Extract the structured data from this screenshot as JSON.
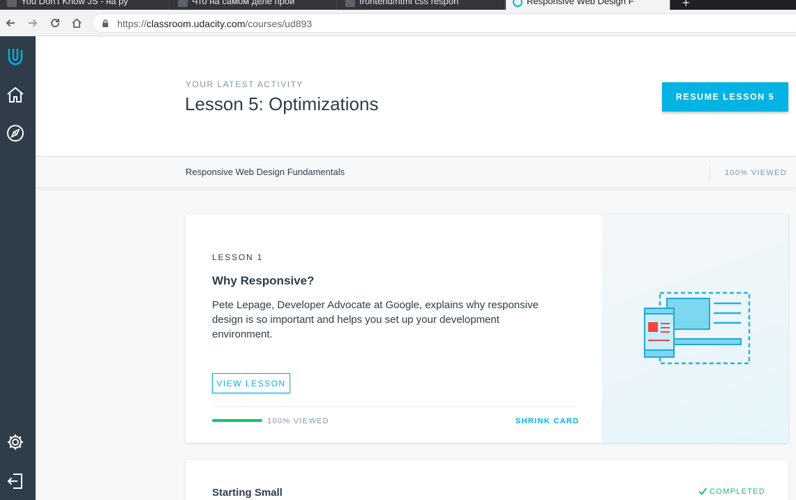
{
  "browser": {
    "tabs": [
      {
        "title": "You Don't Know JS - на ру"
      },
      {
        "title": "Что на самом деле прои"
      },
      {
        "title": "frontend/html css respon"
      },
      {
        "title": "Responsive Web Design F"
      }
    ],
    "url_scheme": "https://",
    "url_host": "classroom.udacity.com",
    "url_path": "/courses/ud893"
  },
  "sidebar": {
    "icons": [
      "udacity-logo-icon",
      "home-icon",
      "compass-icon",
      "settings-icon",
      "logout-icon"
    ]
  },
  "hero": {
    "eyebrow": "YOUR LATEST ACTIVITY",
    "title": "Lesson 5: Optimizations",
    "resume_label": "RESUME LESSON 5"
  },
  "subbar": {
    "course_name": "Responsive Web Design Fundamentals",
    "viewed": "100% VIEWED"
  },
  "lesson_card": {
    "label": "LESSON 1",
    "title": "Why Responsive?",
    "description": "Pete Lepage, Developer Advocate at Google, explains why responsive design is so important and helps you set up your development environment.",
    "view_label": "VIEW LESSON",
    "progress_percent": 100,
    "progress_text": "100% VIEWED",
    "shrink_label": "SHRINK CARD"
  },
  "next_card": {
    "title": "Starting Small",
    "status": "COMPLETED"
  },
  "colors": {
    "accent": "#02b3e4",
    "sidebar": "#2e3d49",
    "success": "#15c26b",
    "muted": "#7d97ad"
  }
}
